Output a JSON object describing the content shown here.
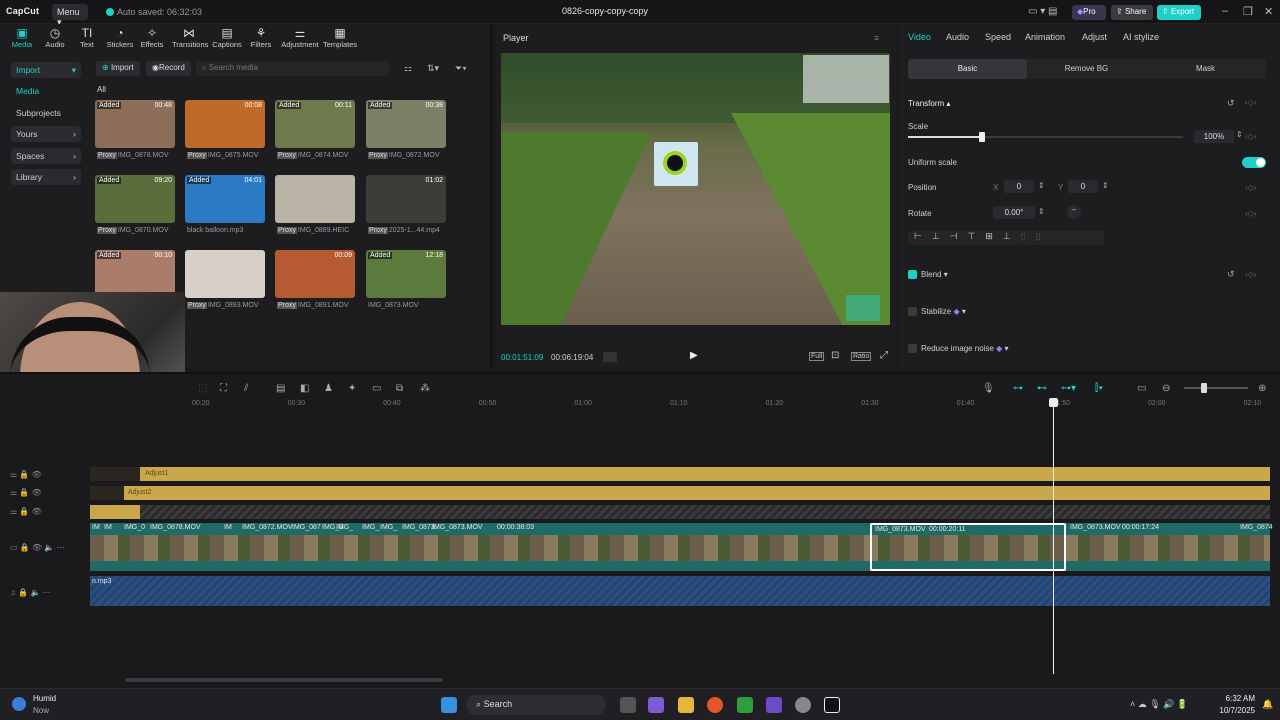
{
  "titlebar": {
    "logo": "CapCut",
    "menu_label": "Menu",
    "autosave": "Auto saved: 06:32:03",
    "project_title": "0826-copy-copy-copy",
    "pro_label": "Pro",
    "share_label": "Share",
    "export_label": "Export"
  },
  "toolbar": {
    "items": [
      "Media",
      "Audio",
      "Text",
      "Stickers",
      "Effects",
      "Transitions",
      "Captions",
      "Filters",
      "Adjustment",
      "Templates"
    ]
  },
  "left_nav": {
    "import": "Import",
    "media": "Media",
    "subprojects": "Subprojects",
    "yours": "Yours",
    "spaces": "Spaces",
    "library": "Library"
  },
  "media": {
    "import_btn": "Import",
    "record_btn": "Record",
    "search_placeholder": "Search media",
    "filter_all": "All",
    "items": [
      {
        "name": "IMG_0878.MOV",
        "badge": "Added",
        "duration": "00:48",
        "proxy": "Proxy"
      },
      {
        "name": "IMG_0875.MOV",
        "badge": "",
        "duration": "00:08",
        "proxy": "Proxy"
      },
      {
        "name": "IMG_0874.MOV",
        "badge": "Added",
        "duration": "00:11",
        "proxy": "Proxy"
      },
      {
        "name": "IMG_0872.MOV",
        "badge": "Added",
        "duration": "00:38",
        "proxy": "Proxy"
      },
      {
        "name": "IMG_0870.MOV",
        "badge": "Added",
        "duration": "09:20",
        "proxy": "Proxy"
      },
      {
        "name": "black balloon.mp3",
        "badge": "Added",
        "duration": "04:01",
        "proxy": ""
      },
      {
        "name": "IMG_0889.HEIC",
        "badge": "",
        "duration": "",
        "proxy": "Proxy"
      },
      {
        "name": "2025-1...44.mp4",
        "badge": "",
        "duration": "01:02",
        "proxy": "Proxy"
      },
      {
        "name": "",
        "badge": "Added",
        "duration": "00:10",
        "proxy": ""
      },
      {
        "name": "IMG_0893.MOV",
        "badge": "",
        "duration": "",
        "proxy": "Proxy"
      },
      {
        "name": "IMG_0891.MOV",
        "badge": "",
        "duration": "00:09",
        "proxy": "Proxy"
      },
      {
        "name": "IMG_0873.MOV",
        "badge": "Added",
        "duration": "12:18",
        "proxy": ""
      }
    ]
  },
  "player": {
    "title": "Player",
    "current_time": "00:01:51:09",
    "total_time": "00:06:19:04",
    "full_label": "Full",
    "ratio_label": "Ratio"
  },
  "inspector": {
    "tabs": [
      "Video",
      "Audio",
      "Speed",
      "Animation",
      "Adjust",
      "AI stylize"
    ],
    "subtabs": [
      "Basic",
      "Remove BG",
      "Mask"
    ],
    "transform_label": "Transform",
    "scale_label": "Scale",
    "scale_value": "100%",
    "scale_fraction": 0.27,
    "uniform_scale_label": "Uniform scale",
    "position_label": "Position",
    "pos_x_label": "X",
    "pos_x": "0",
    "pos_y_label": "Y",
    "pos_y": "0",
    "rotate_label": "Rotate",
    "rotate_value": "0.00°",
    "blend_label": "Blend",
    "stabilize_label": "Stabilize",
    "noise_label": "Reduce image noise"
  },
  "timeline": {
    "ruler": [
      "00:20",
      "00:30",
      "00:40",
      "00:50",
      "01:00",
      "01:10",
      "01:20",
      "01:30",
      "01:40",
      "01:50",
      "02:00",
      "02:10"
    ],
    "adjust1_label": "Adjust1",
    "adjust2_label": "Adjust2",
    "video_clip_labels": [
      "IM",
      "IM",
      "IMG_0",
      "IMG_0878.MOV",
      "IM",
      "IMG_0872.MOV",
      "IMG_087",
      "IMG_0",
      "IMG_",
      "IMG_",
      "IMG_",
      "IMG_0873.",
      "IMG_0873.MOV",
      "00:00:38:03"
    ],
    "selected_clip_name": "IMG_0873.MOV",
    "selected_clip_dur": "00:00:20:11",
    "next_clip_name": "IMG_0873.MOV",
    "next_clip_dur": "00:00:17:24",
    "last_clip_name": "IMG_0874",
    "audio_label": "n.mp3"
  },
  "taskbar": {
    "weather_title": "Humid",
    "weather_sub": "Now",
    "search_label": "Search",
    "time": "6:32 AM",
    "date": "10/7/2025"
  },
  "colors": {
    "accent": "#1fd0c8",
    "adjust_track": "#c9a74a",
    "video_track": "#1e6a66",
    "audio_track": "#2a4f80"
  }
}
